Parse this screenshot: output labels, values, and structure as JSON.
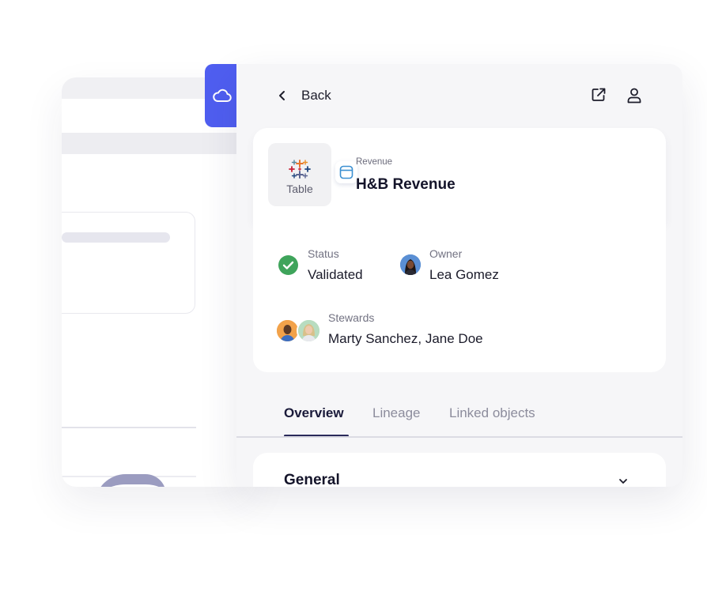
{
  "nav": {
    "back_label": "Back"
  },
  "asset": {
    "thumb_label": "Table",
    "breadcrumb": "Revenue",
    "title": "H&B Revenue"
  },
  "fields": {
    "status": {
      "label": "Status",
      "value": "Validated",
      "color": "#3fa45b"
    },
    "owner": {
      "label": "Owner",
      "value": "Lea Gomez"
    },
    "stewards": {
      "label": "Stewards",
      "value": "Marty Sanchez, Jane Doe"
    }
  },
  "tabs": [
    {
      "label": "Overview",
      "active": true
    },
    {
      "label": "Lineage",
      "active": false
    },
    {
      "label": "Linked objects",
      "active": false
    }
  ],
  "section": {
    "title": "General"
  },
  "colors": {
    "brand": "#4f5ef0",
    "tab_active": "#2a2a5a"
  },
  "icons": [
    "cloud-icon",
    "chevron-left-icon",
    "external-link-icon",
    "user-icon",
    "tableau-icon",
    "table-icon",
    "check-circle-icon",
    "chevron-down-icon"
  ]
}
